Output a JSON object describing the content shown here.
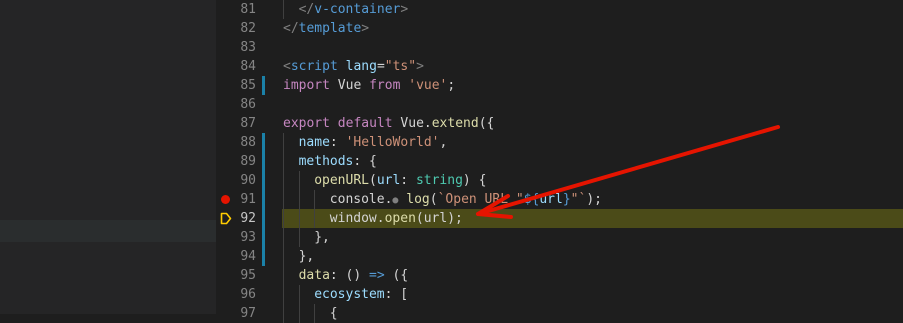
{
  "editor": {
    "current_line": "92",
    "lines": [
      {
        "num": "81",
        "bp": false,
        "cur": false,
        "mod": false,
        "indent": 1,
        "tokens": [
          {
            "t": "</",
            "c": "bn"
          },
          {
            "t": "v-container",
            "c": "tag"
          },
          {
            "t": ">",
            "c": "bn"
          }
        ]
      },
      {
        "num": "82",
        "bp": false,
        "cur": false,
        "mod": false,
        "indent": 0,
        "tokens": [
          {
            "t": "</",
            "c": "bn"
          },
          {
            "t": "template",
            "c": "tag"
          },
          {
            "t": ">",
            "c": "bn"
          }
        ]
      },
      {
        "num": "83",
        "bp": false,
        "cur": false,
        "mod": false,
        "indent": 0,
        "tokens": []
      },
      {
        "num": "84",
        "bp": false,
        "cur": false,
        "mod": false,
        "indent": 0,
        "tokens": [
          {
            "t": "<",
            "c": "bn"
          },
          {
            "t": "script",
            "c": "tag"
          },
          {
            "t": " ",
            "c": ""
          },
          {
            "t": "lang",
            "c": "p"
          },
          {
            "t": "=",
            "c": ""
          },
          {
            "t": "\"ts\"",
            "c": "s"
          },
          {
            "t": ">",
            "c": "bn"
          }
        ]
      },
      {
        "num": "85",
        "bp": false,
        "cur": false,
        "mod": true,
        "indent": 0,
        "tokens": [
          {
            "t": "import",
            "c": "kc"
          },
          {
            "t": " Vue ",
            "c": ""
          },
          {
            "t": "from",
            "c": "kc"
          },
          {
            "t": " ",
            "c": ""
          },
          {
            "t": "'vue'",
            "c": "s"
          },
          {
            "t": ";",
            "c": ""
          }
        ]
      },
      {
        "num": "86",
        "bp": false,
        "cur": false,
        "mod": false,
        "indent": 0,
        "tokens": []
      },
      {
        "num": "87",
        "bp": false,
        "cur": false,
        "mod": false,
        "indent": 0,
        "tokens": [
          {
            "t": "export",
            "c": "kc"
          },
          {
            "t": " ",
            "c": ""
          },
          {
            "t": "default",
            "c": "kc"
          },
          {
            "t": " Vue.",
            "c": ""
          },
          {
            "t": "extend",
            "c": "f"
          },
          {
            "t": "({",
            "c": ""
          }
        ]
      },
      {
        "num": "88",
        "bp": false,
        "cur": false,
        "mod": true,
        "indent": 1,
        "tokens": [
          {
            "t": "name",
            "c": "p"
          },
          {
            "t": ": ",
            "c": ""
          },
          {
            "t": "'HelloWorld'",
            "c": "s"
          },
          {
            "t": ",",
            "c": ""
          }
        ]
      },
      {
        "num": "89",
        "bp": false,
        "cur": false,
        "mod": true,
        "indent": 1,
        "tokens": [
          {
            "t": "methods",
            "c": "p"
          },
          {
            "t": ": {",
            "c": ""
          }
        ]
      },
      {
        "num": "90",
        "bp": false,
        "cur": false,
        "mod": true,
        "indent": 2,
        "tokens": [
          {
            "t": "openURL",
            "c": "f"
          },
          {
            "t": "(",
            "c": ""
          },
          {
            "t": "url",
            "c": "p"
          },
          {
            "t": ": ",
            "c": ""
          },
          {
            "t": "string",
            "c": "t"
          },
          {
            "t": ") {",
            "c": ""
          }
        ]
      },
      {
        "num": "91",
        "bp": true,
        "cur": false,
        "mod": true,
        "indent": 3,
        "tokens": [
          {
            "t": "console.",
            "c": ""
          },
          {
            "t": "●",
            "c": "dot"
          },
          {
            "t": " ",
            "c": ""
          },
          {
            "t": "log",
            "c": "f"
          },
          {
            "t": "(",
            "c": ""
          },
          {
            "t": "`Open URL \"",
            "c": "s"
          },
          {
            "t": "${",
            "c": "k"
          },
          {
            "t": "url",
            "c": "p"
          },
          {
            "t": "}",
            "c": "k"
          },
          {
            "t": "\"`",
            "c": "s"
          },
          {
            "t": ");",
            "c": ""
          }
        ]
      },
      {
        "num": "92",
        "bp": false,
        "cur": true,
        "mod": true,
        "indent": 3,
        "tokens": [
          {
            "t": "window.",
            "c": ""
          },
          {
            "t": "open",
            "c": "f"
          },
          {
            "t": "(url);",
            "c": ""
          }
        ]
      },
      {
        "num": "93",
        "bp": false,
        "cur": false,
        "mod": true,
        "indent": 2,
        "tokens": [
          {
            "t": "},",
            "c": ""
          }
        ]
      },
      {
        "num": "94",
        "bp": false,
        "cur": false,
        "mod": true,
        "indent": 1,
        "tokens": [
          {
            "t": "},",
            "c": ""
          }
        ]
      },
      {
        "num": "95",
        "bp": false,
        "cur": false,
        "mod": false,
        "indent": 1,
        "tokens": [
          {
            "t": "data",
            "c": "f"
          },
          {
            "t": ": () ",
            "c": ""
          },
          {
            "t": "=>",
            "c": "k"
          },
          {
            "t": " ({",
            "c": ""
          }
        ]
      },
      {
        "num": "96",
        "bp": false,
        "cur": false,
        "mod": false,
        "indent": 2,
        "tokens": [
          {
            "t": "ecosystem",
            "c": "p"
          },
          {
            "t": ": [",
            "c": ""
          }
        ]
      },
      {
        "num": "97",
        "bp": false,
        "cur": false,
        "mod": false,
        "indent": 3,
        "tokens": [
          {
            "t": "{",
            "c": ""
          }
        ]
      }
    ]
  },
  "annotation": {
    "color": "#e51400"
  },
  "icons": {
    "breakpoint": "breakpoint-dot-icon",
    "debug_pointer": "debug-pointer-icon"
  }
}
